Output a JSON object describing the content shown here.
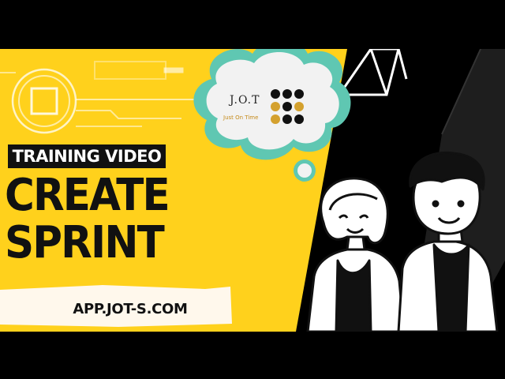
{
  "banner": {
    "label": "TRAINING VIDEO"
  },
  "headline": {
    "line1": "CREATE",
    "line2": "SPRINT"
  },
  "website": {
    "url": "APP.JOT-S.COM"
  },
  "logo": {
    "title": "J.O.T",
    "tagline": "Just On Time"
  },
  "colors": {
    "yellow": "#ffd11c",
    "black": "#000000",
    "teal": "#5fc7b2",
    "gold": "#d4a12e"
  }
}
